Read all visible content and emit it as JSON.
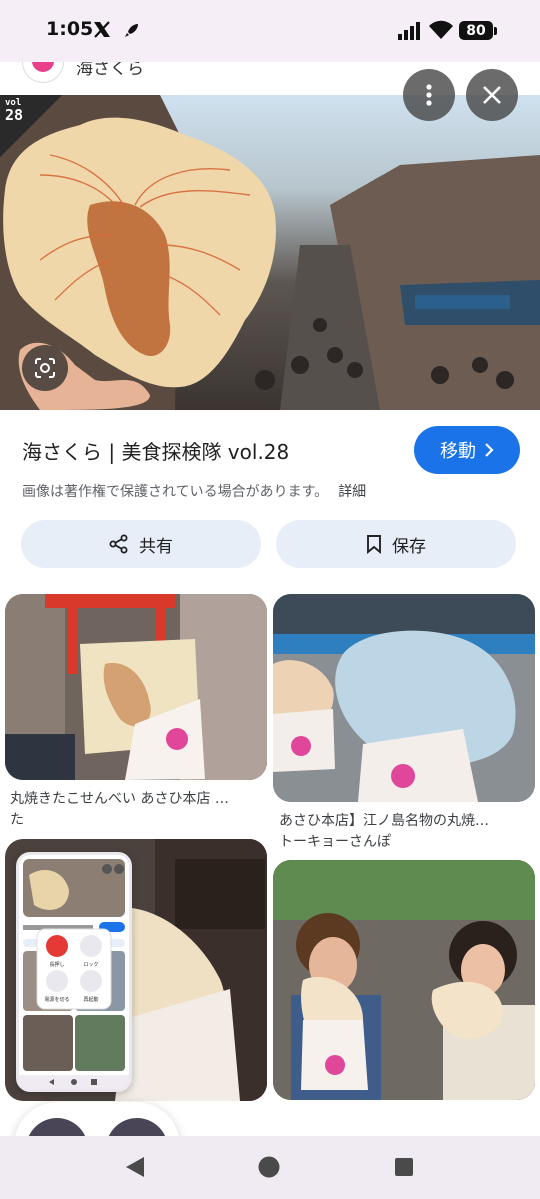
{
  "status_bar": {
    "time": "1:05",
    "battery": "80"
  },
  "source": {
    "name": "海さくら"
  },
  "hero": {
    "badge_top": "vol",
    "badge_num": "28"
  },
  "result": {
    "title": "海さくら | 美食探検隊 vol.28",
    "move_label": "移動",
    "copyright_note": "画像は著作権で保護されている場合があります。",
    "details_link": "詳細"
  },
  "actions": {
    "share_label": "共有",
    "save_label": "保存"
  },
  "related": [
    {
      "caption_line1": "丸焼きたこせんべい あさひ本店 …",
      "caption_line2": "た"
    },
    {
      "caption_line1": "あさひ本店】江ノ島名物の丸焼…",
      "caption_line2": "トーキョーさんぽ"
    }
  ],
  "mini_preview": {
    "labels": [
      "長押し",
      "ロック",
      "電源を切る",
      "再起動"
    ]
  },
  "colors": {
    "accent": "#1a73e8",
    "pill": "#e8eef8",
    "tool": "#4a4556"
  }
}
